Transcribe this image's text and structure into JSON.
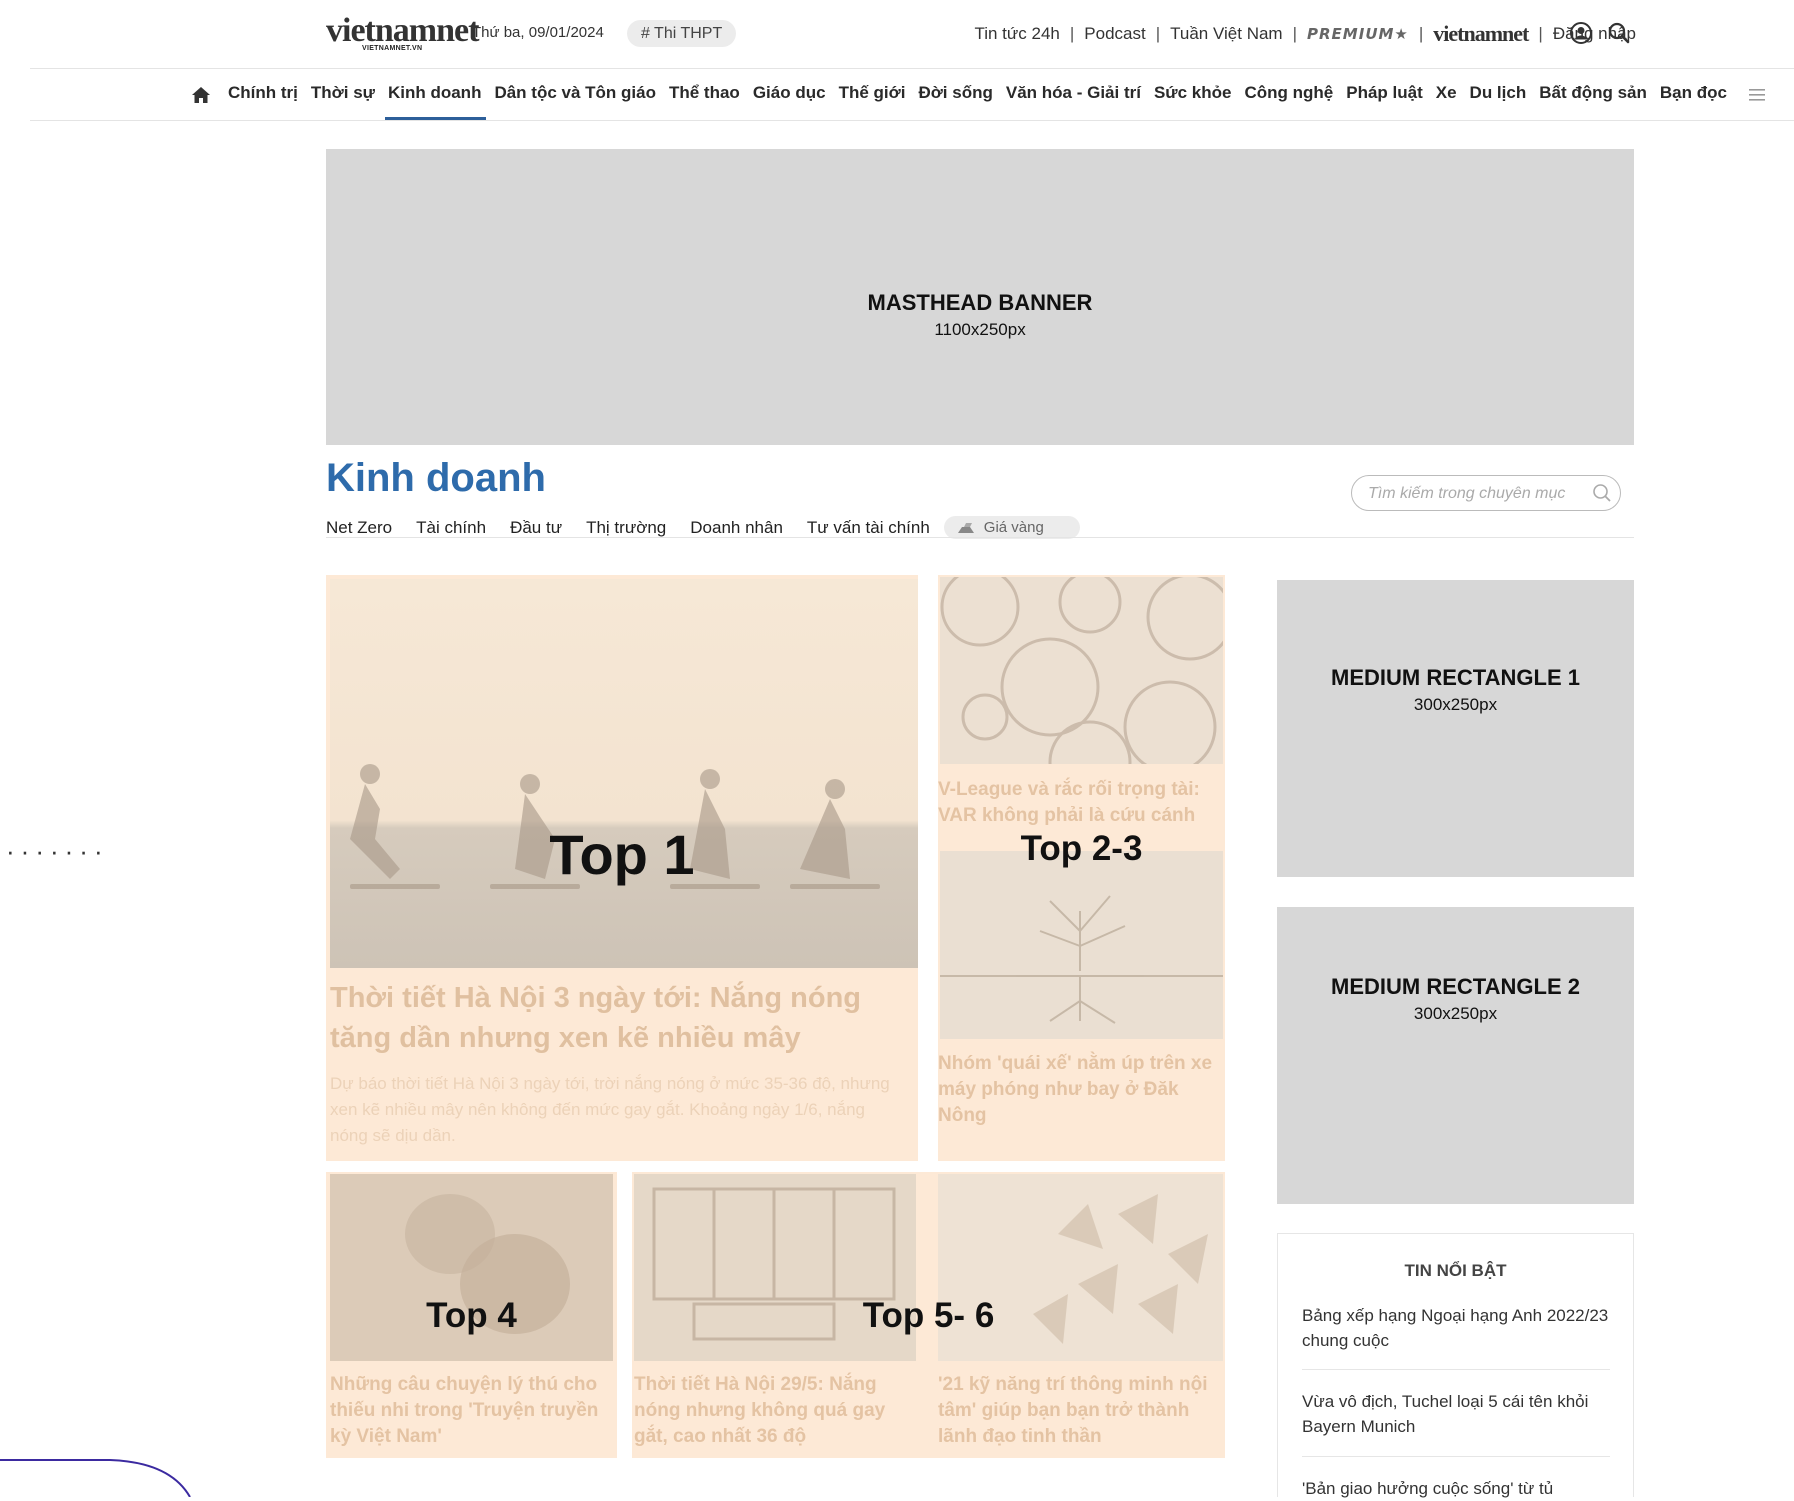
{
  "header": {
    "logo_text": "vietnamnet",
    "logo_sub": "VIETNAMNET.VN",
    "date": "Thứ ba, 09/01/2024",
    "hashtag": "# Thi THPT",
    "links": [
      "Tin tức 24h",
      "Podcast",
      "Tuần Việt Nam"
    ],
    "premium": "PREMIUM★",
    "global_logo": "vietnamnet",
    "login": "Đăng nhập",
    "icons": [
      "user-icon",
      "search-icon"
    ]
  },
  "nav": {
    "home_icon": "home-icon",
    "items": [
      "Chính trị",
      "Thời sự",
      "Kinh doanh",
      "Dân tộc và Tôn giáo",
      "Thể thao",
      "Giáo dục",
      "Thế giới",
      "Đời sống",
      "Văn hóa - Giải trí",
      "Sức khỏe",
      "Công nghệ",
      "Pháp luật",
      "Xe",
      "Du lịch",
      "Bất động sản",
      "Bạn đọc"
    ],
    "active": "Kinh doanh",
    "menu_icon": "hamburger-icon"
  },
  "masthead": {
    "title": "MASTHEAD BANNER",
    "size": "1100x250px"
  },
  "section": {
    "title": "Kinh doanh",
    "subnav": [
      "Net Zero",
      "Tài chính",
      "Đầu tư",
      "Thị trường",
      "Doanh nhân",
      "Tư vấn tài chính"
    ],
    "gold": "Giá vàng",
    "search_placeholder": "Tìm kiếm trong chuyên mục"
  },
  "top1": {
    "label": "Top 1",
    "title": "Thời tiết Hà Nội 3 ngày tới: Nắng nóng tăng dần nhưng xen kẽ nhiều mây",
    "summary": "Dự báo thời tiết Hà Nội 3 ngày tới, trời nắng nóng ở mức 35-36 độ, nhưng xen kẽ nhiều mây nên không đến mức gay gắt. Khoảng ngày 1/6, nắng nóng sẽ dịu dần."
  },
  "top23": {
    "label": "Top 2-3",
    "title_a": "V-League và rắc rối trọng tài: VAR không phải là cứu cánh",
    "title_b": "Nhóm 'quái xế' nằm úp trên xe máy phóng như bay ở Đăk Nông"
  },
  "top4": {
    "label": "Top 4",
    "title": "Những câu chuyện lý thú cho thiếu nhi trong 'Truyện truyền kỳ Việt Nam'"
  },
  "top56": {
    "label": "Top 5- 6",
    "title_a": "Thời tiết Hà Nội 29/5: Nắng nóng nhưng không quá gay gắt, cao nhất 36 độ",
    "title_b": "'21 kỹ năng trí thông minh nội tâm' giúp bạn bạn trở thành lãnh đạo tinh thần"
  },
  "rect1": {
    "title": "MEDIUM RECTANGLE 1",
    "size": "300x250px"
  },
  "rect2": {
    "title": "MEDIUM RECTANGLE 2",
    "size": "300x250px"
  },
  "hot": {
    "title": "TIN NỔI BẬT",
    "items": [
      "Bảng xếp hạng Ngoại hạng Anh 2022/23 chung cuộc",
      "Vừa vô địch, Tuchel loại 5 cái tên khỏi Bayern Munich",
      "'Bản giao hưởng cuộc sống' từ tủ"
    ]
  },
  "decor": {
    "dots": "·······"
  }
}
